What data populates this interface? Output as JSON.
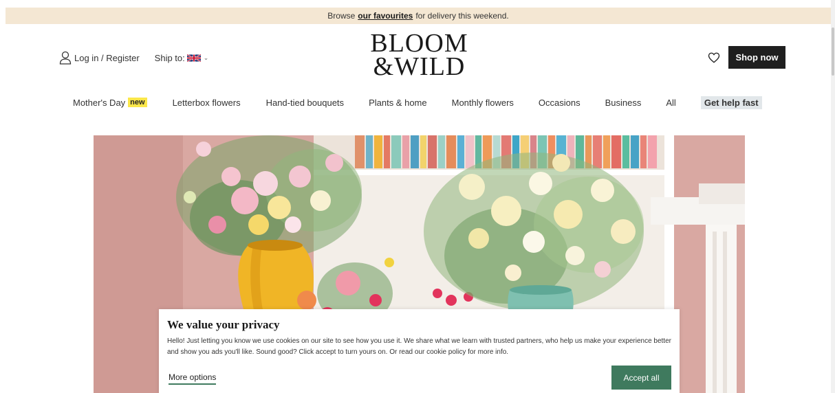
{
  "promo": {
    "prefix": "Browse",
    "link": "our favourites",
    "suffix": "for delivery this weekend."
  },
  "header": {
    "login_label": "Log in / Register",
    "ship_label": "Ship to:",
    "ship_flag": "uk-flag-icon",
    "logo_line1": "BLOOM",
    "logo_line2": "&WILD",
    "shop_button": "Shop now"
  },
  "nav": {
    "items": [
      {
        "label": "Mother's Day",
        "badge": "new"
      },
      {
        "label": "Letterbox flowers"
      },
      {
        "label": "Hand-tied bouquets"
      },
      {
        "label": "Plants & home"
      },
      {
        "label": "Monthly flowers"
      },
      {
        "label": "Occasions"
      },
      {
        "label": "Business"
      },
      {
        "label": "All"
      },
      {
        "label": "Get help fast"
      }
    ]
  },
  "cookie": {
    "title": "We value your privacy",
    "body": "Hello! Just letting you know we use cookies on our site to see how you use it. We share what we learn with trusted partners, who help us make your experience better and show you ads you'll like. Sound good? Click accept to turn yours on. Or read our cookie policy for more info.",
    "more_options": "More options",
    "accept_all": "Accept all"
  },
  "colors": {
    "promo_bg": "#f4e7d3",
    "accent_green": "#3f7a5e",
    "badge_yellow": "#fbe74a",
    "dark_button": "#1f1f1f"
  }
}
